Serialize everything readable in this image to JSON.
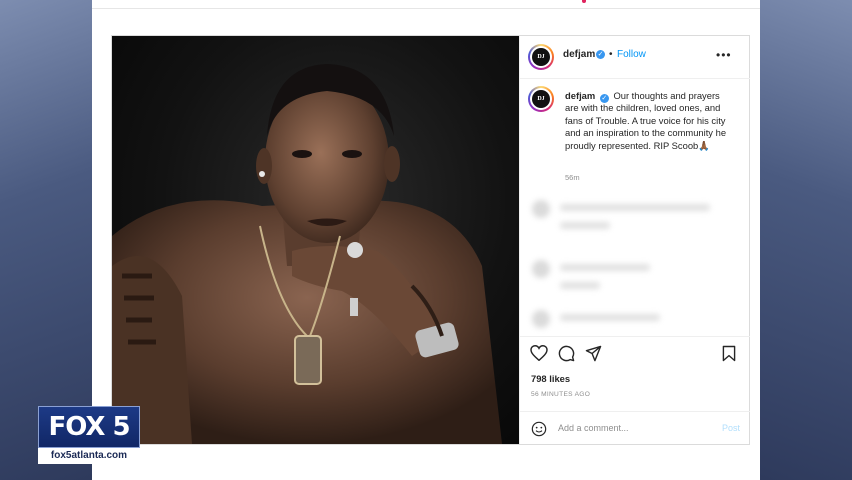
{
  "post": {
    "username": "defjam",
    "follow_label": "Follow",
    "separator": "•",
    "more_label": "•••",
    "avatar_text": "DJ",
    "caption_username": "defjam",
    "caption_text": "Our thoughts and prayers are with the children, loved ones, and fans of Trouble. A true voice for his city and an inspiration to the community he proudly represented. RIP Scoob🙏🏾",
    "caption_time": "56m",
    "likes": "798 likes",
    "timestamp": "56 MINUTES AGO",
    "comment_placeholder": "Add a comment...",
    "post_label": "Post"
  },
  "icons": {
    "verified": "verified-badge-icon",
    "like": "heart-icon",
    "comment": "comment-icon",
    "share": "paper-plane-icon",
    "save": "bookmark-icon",
    "emoji": "emoji-icon"
  },
  "broadcast": {
    "logo_text": "FOX 5",
    "url": "fox5atlanta.com"
  },
  "colors": {
    "follow": "#0095f6",
    "verified": "#3897f0",
    "fox_blue": "#1d3a86"
  }
}
